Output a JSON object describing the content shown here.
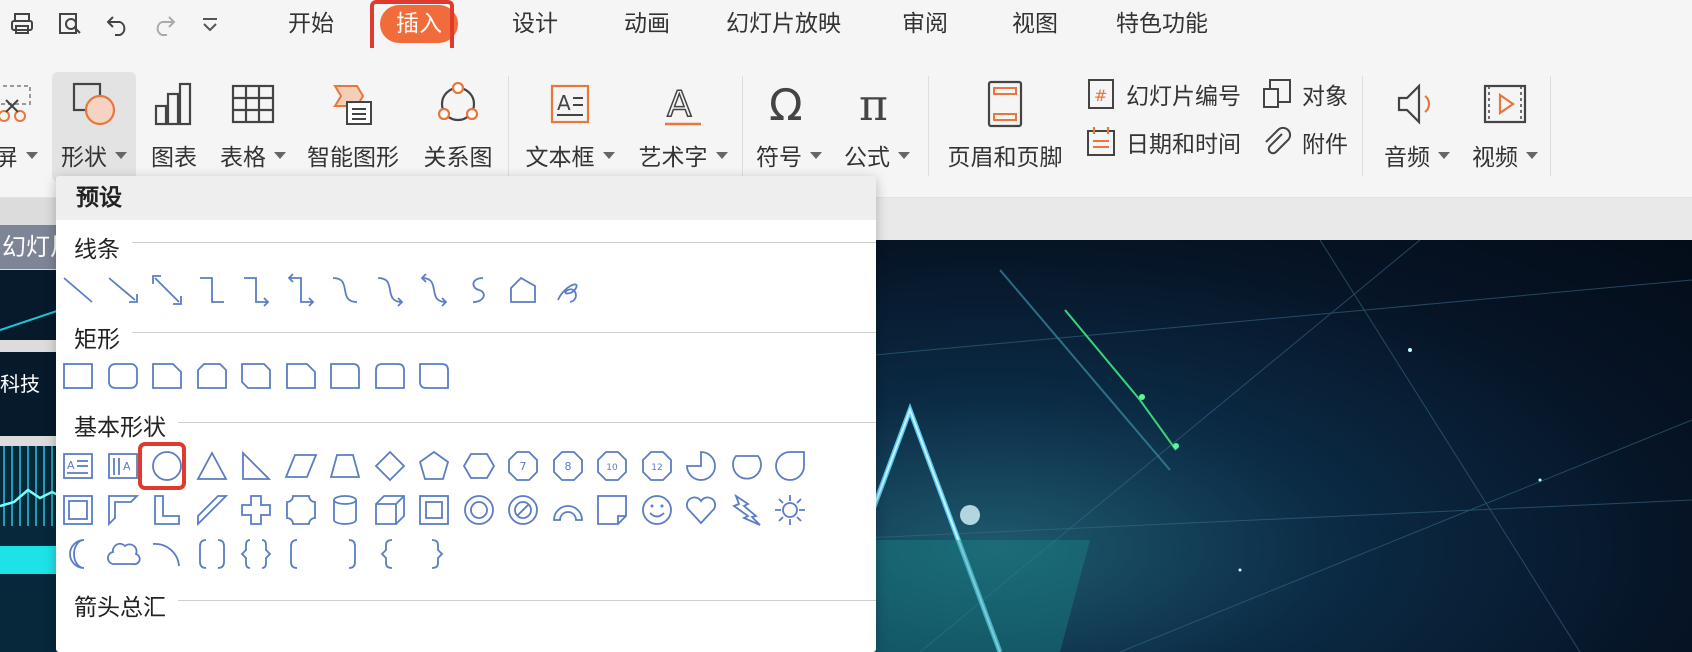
{
  "menu": {
    "tabs": [
      "开始",
      "插入",
      "设计",
      "动画",
      "幻灯片放映",
      "审阅",
      "视图",
      "特色功能"
    ],
    "active": "插入"
  },
  "ribbon": {
    "screen_label": "屏",
    "shape_label": "形状",
    "chart_label": "图表",
    "table_label": "表格",
    "smartart_label": "智能图形",
    "relation_label": "关系图",
    "textbox_label": "文本框",
    "wordart_label": "艺术字",
    "symbol_label": "符号",
    "formula_label": "公式",
    "header_footer_label": "页眉和页脚",
    "slide_number_label": "幻灯片编号",
    "datetime_label": "日期和时间",
    "object_label": "对象",
    "attachment_label": "附件",
    "audio_label": "音频",
    "video_label": "视频"
  },
  "icons": {
    "slide_number_glyph": "#",
    "textbox_glyph": "A",
    "wordart_glyph": "A",
    "symbol_glyph": "Ω",
    "formula_glyph": "π"
  },
  "left_pane": {
    "slide_tab_label": "幻灯片",
    "thumb_text": "科技"
  },
  "dropdown": {
    "header": "预设",
    "sections": {
      "lines": "线条",
      "rectangles": "矩形",
      "basic": "基本形状",
      "arrows": "箭头总汇"
    },
    "number_badges": [
      "7",
      "8",
      "10",
      "12"
    ]
  },
  "colors": {
    "accent": "#f26b3a",
    "highlight_border": "#e03a2f",
    "shape_stroke": "#5a7dc4",
    "icon_orange": "#e8773d"
  }
}
